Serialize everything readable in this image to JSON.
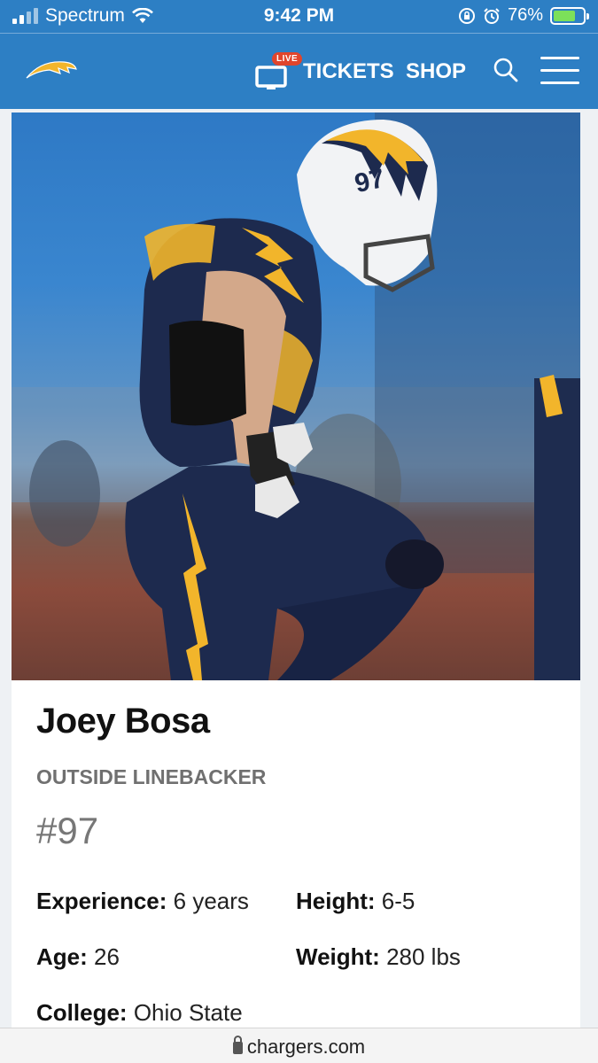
{
  "status_bar": {
    "carrier": "Spectrum",
    "time": "9:42 PM",
    "battery": "76%",
    "battery_level": 0.76
  },
  "header": {
    "live_badge": "LIVE",
    "tickets": "TICKETS",
    "shop": "SHOP"
  },
  "player": {
    "name": "Joey Bosa",
    "position": "OUTSIDE LINEBACKER",
    "number": "#97",
    "helmet_number": "97",
    "stats": {
      "experience_label": "Experience:",
      "experience_value": "6 years",
      "height_label": "Height:",
      "height_value": "6-5",
      "age_label": "Age:",
      "age_value": "26",
      "weight_label": "Weight:",
      "weight_value": "280 lbs",
      "college_label": "College:",
      "college_value": "Ohio State"
    }
  },
  "url_bar": {
    "domain": "chargers.com"
  },
  "colors": {
    "brand_blue": "#2d7fc4",
    "navy": "#1d2a4e",
    "gold": "#f2b52b",
    "live_red": "#e0452c"
  }
}
